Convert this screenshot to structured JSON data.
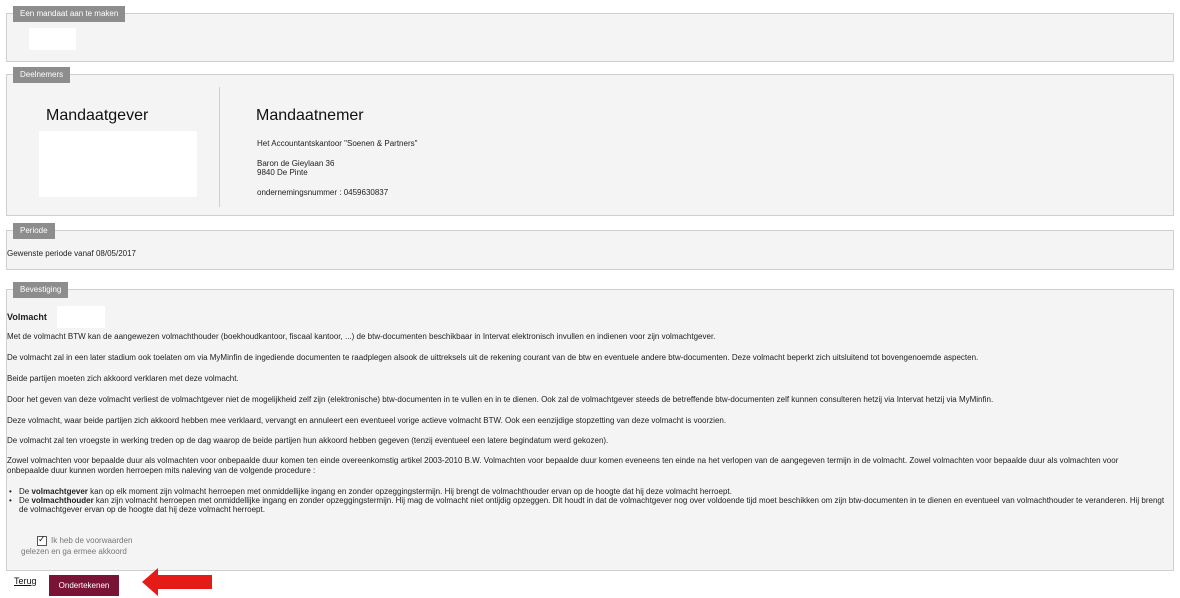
{
  "sections": {
    "mandaat": {
      "legend": "Een mandaat aan te maken"
    },
    "deelnemers": {
      "legend": "Deelnemers",
      "giver_title": "Mandaatgever",
      "receiver_title": "Mandaatnemer",
      "receiver_name": "Het Accountantskantoor \"Soenen & Partners\"",
      "receiver_street": "Baron de Gieylaan 36",
      "receiver_city": "9840 De Pinte",
      "receiver_company_number": "ondernemingsnummer : 0459630837"
    },
    "periode": {
      "legend": "Periode",
      "text": "Gewenste periode vanaf 08/05/2017"
    },
    "bevestiging": {
      "legend": "Bevestiging",
      "heading": "Volmacht",
      "paragraphs": [
        "Met de volmacht BTW kan de aangewezen volmachthouder (boekhoudkantoor, fiscaal kantoor, ...) de btw-documenten beschikbaar in Intervat elektronisch invullen en indienen voor zijn volmachtgever.",
        "De volmacht zal in een later stadium ook toelaten om via MyMinfin de ingediende documenten te raadplegen alsook de uittreksels uit de rekening courant van de btw en eventuele andere btw-documenten. Deze volmacht beperkt zich uitsluitend tot bovengenoemde aspecten.",
        "Beide partijen moeten zich akkoord verklaren met deze volmacht.",
        "Door het geven van deze volmacht verliest de volmachtgever niet de mogelijkheid zelf zijn (elektronische) btw-documenten in te vullen en in te dienen. Ook zal de volmachtgever steeds de betreffende btw-documenten zelf kunnen consulteren hetzij via Intervat hetzij via MyMinfin.",
        "Deze volmacht, waar beide partijen zich akkoord hebben mee verklaard, vervangt en annuleert een eventueel vorige actieve volmacht BTW. Ook een eenzijdige stopzetting van deze volmacht is voorzien.",
        "De volmacht zal ten vroegste in werking treden op de dag waarop de beide partijen hun akkoord hebben gegeven (tenzij eventueel een latere begindatum werd gekozen).",
        "Zowel volmachten voor bepaalde duur als volmachten voor onbepaalde duur komen ten einde overeenkomstig artikel 2003-2010 B.W. Volmachten voor bepaalde duur komen eveneens ten einde na het verlopen van de aangegeven termijn in de volmacht. Zowel volmachten voor bepaalde duur als volmachten voor onbepaalde duur kunnen worden herroepen mits naleving van de volgende procedure :"
      ],
      "bullet1_pre": "De ",
      "bullet1_bold": "volmachtgever",
      "bullet1_post": " kan op elk moment zijn volmacht herroepen met onmiddellijke ingang en zonder opzeggingstermijn. Hij brengt de volmachthouder ervan op de hoogte dat hij deze volmacht herroept.",
      "bullet2_pre": "De ",
      "bullet2_bold": "volmachthouder",
      "bullet2_post": " kan zijn volmacht herroepen met onmiddellijke ingang en zonder opzeggingstermijn. Hij mag de volmacht niet ontijdig opzeggen. Dit houdt in dat de volmachtgever nog over voldoende tijd moet beschikken om zijn btw-documenten in te dienen en eventueel van volmachthouder te veranderen. Hij brengt de volmachtgever ervan op de hoogte dat hij deze volmacht herroept.",
      "checkbox_label_line1": "Ik heb de voorwaarden",
      "checkbox_label_line2": "gelezen en ga ermee akkoord",
      "checkbox_checked": true
    }
  },
  "footer": {
    "back_link": "Terug",
    "sign_button": "Ondertekenen"
  },
  "colors": {
    "legend_bg": "#8d8d8d",
    "button_bg": "#7a1436",
    "arrow": "#e41b17",
    "panel_bg": "#f4f4f4"
  }
}
